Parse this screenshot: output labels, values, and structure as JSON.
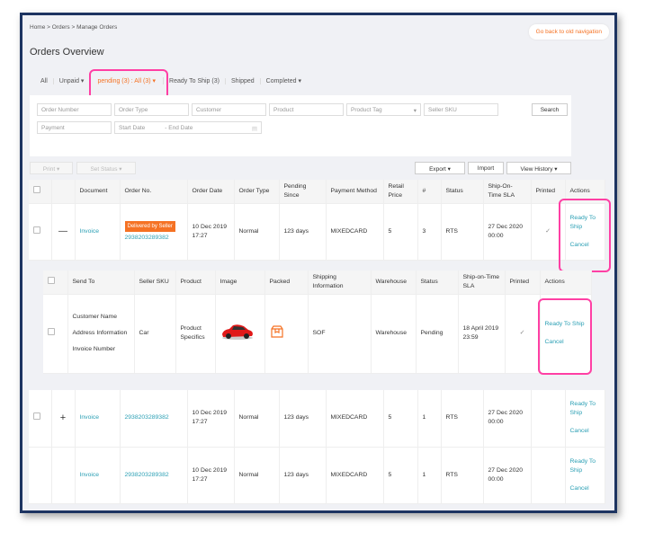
{
  "breadcrumb": [
    "Home",
    ">",
    "Orders",
    ">",
    "Manage Orders"
  ],
  "old_nav_label": "Go back to old navigation",
  "page_title": "Orders Overview",
  "tabs": [
    {
      "label": "All"
    },
    {
      "label": "Unpaid ▾"
    },
    {
      "label": "pending (3) : All (3) ▾"
    },
    {
      "label": "Ready To Ship (3)"
    },
    {
      "label": "Shipped"
    },
    {
      "label": "Completed ▾"
    }
  ],
  "filters": {
    "order_number": "Order Number",
    "order_type": "Order Type",
    "customer": "Customer",
    "product": "Product",
    "product_tag": "Product Tag",
    "seller_sku": "Seller SKU",
    "payment": "Payment",
    "start_date": "Start Date",
    "dash": "-",
    "end_date": "End Date",
    "search": "Search"
  },
  "toolbar": {
    "print": "Print ▾",
    "set_status": "Set Status ▾",
    "export": "Export ▾",
    "import": "Import",
    "view_history": "View History ▾"
  },
  "headers": [
    "Document",
    "Order No.",
    "Order Date",
    "Order Type",
    "Pending Since",
    "Payment Method",
    "Retail Price",
    "#",
    "Status",
    "Ship-On-Time SLA",
    "Printed",
    "Actions"
  ],
  "orders": [
    {
      "document": "Invoice",
      "badge": "Delivered by Seller",
      "order_no": "2938203289382",
      "order_date": "10 Dec 2019 17:27",
      "order_type": "Normal",
      "pending": "123 days",
      "payment": "MIXEDCARD",
      "price": "5",
      "qty": "3",
      "status": "RTS",
      "sla": "27 Dec 2020 00:00",
      "printed": "✓",
      "action1": "Ready To Ship",
      "action2": "Cancel",
      "expand": "—"
    },
    {
      "document": "Invoice",
      "order_no": "2938203289382",
      "order_date": "10 Dec 2019 17:27",
      "order_type": "Normal",
      "pending": "123 days",
      "payment": "MIXEDCARD",
      "price": "5",
      "qty": "1",
      "status": "RTS",
      "sla": "27 Dec 2020 00:00",
      "action1": "Ready To Ship",
      "action2": "Cancel",
      "expand": "+"
    },
    {
      "document": "Invoice",
      "order_no": "2938203289382",
      "order_date": "10 Dec 2019 17:27",
      "order_type": "Normal",
      "pending": "123 days",
      "payment": "MIXEDCARD",
      "price": "5",
      "qty": "1",
      "status": "RTS",
      "sla": "27 Dec 2020 00:00",
      "action1": "Ready To Ship",
      "action2": "Cancel"
    }
  ],
  "sub_headers": [
    "Send To",
    "Seller SKU",
    "Product",
    "Image",
    "Packed",
    "Shipping Information",
    "Warehouse",
    "Status",
    "Ship-on-Time SLA",
    "Printed",
    "Actions"
  ],
  "sub_item": {
    "customer": "Customer Name",
    "address": "Address Information",
    "invoice": "Invoice Number",
    "sku": "Car",
    "product": "Product Specifics",
    "shipping": "SOF",
    "warehouse": "Warehouse",
    "status": "Pending",
    "sla": "18 April 2019 23:59",
    "printed": "✓",
    "action1": "Ready To Ship",
    "action2": "Cancel"
  },
  "colors": {
    "accent": "#f57224",
    "link": "#2a9fb4",
    "highlight": "#ff3fa4",
    "frame": "#1d3461"
  }
}
